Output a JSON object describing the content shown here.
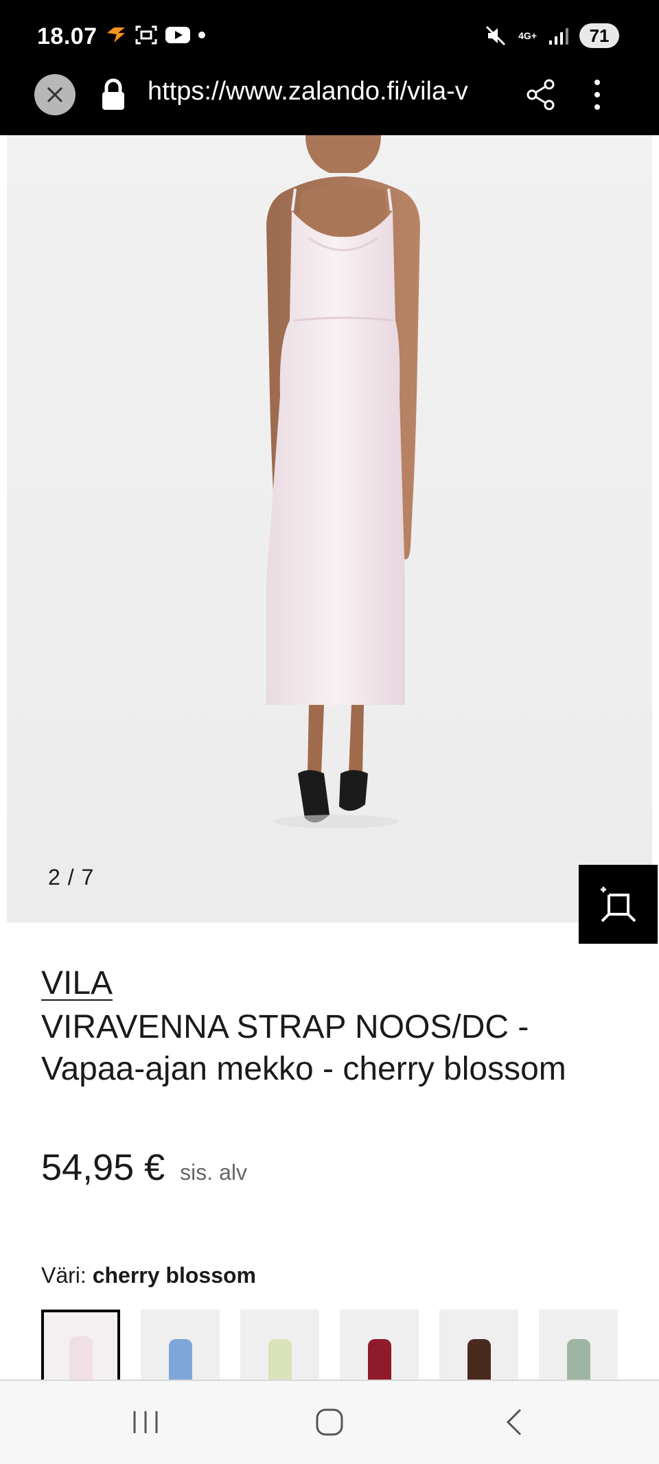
{
  "status_bar": {
    "time": "18.07",
    "network": "4G+",
    "battery": "71"
  },
  "browser": {
    "url": "https://www.zalando.fi/vila-v"
  },
  "gallery": {
    "counter": "2 / 7"
  },
  "product": {
    "brand": "VILA",
    "title": "VIRAVENNA STRAP NOOS/DC - Vapaa-ajan mekko - cherry blossom",
    "price": "54,95 €",
    "vat_note": "sis. alv",
    "color_label": "Väri:",
    "color_value": "cherry blossom"
  },
  "swatches": [
    {
      "name": "cherry-blossom",
      "color": "#f1dfe6",
      "selected": true
    },
    {
      "name": "blue",
      "color": "#7fa6d9"
    },
    {
      "name": "floral",
      "color": "#d9e2b9"
    },
    {
      "name": "red",
      "color": "#8e1a2a"
    },
    {
      "name": "brown",
      "color": "#4a2a1e"
    },
    {
      "name": "sage",
      "color": "#9fb5a3"
    }
  ],
  "icons": {
    "close": "close-icon",
    "lock": "lock-icon",
    "share": "share-icon",
    "more": "more-vertical-icon",
    "ai_search": "ai-crop-search-icon",
    "nav_recent": "recent-apps-icon",
    "nav_home": "home-icon",
    "nav_back": "back-icon"
  }
}
